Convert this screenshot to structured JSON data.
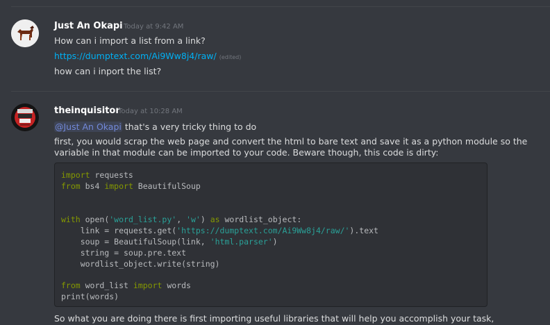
{
  "messages": [
    {
      "username": "Just An Okapi",
      "timestamp": "Today at 9:42 AM",
      "lines": [
        "How can i import a list from a link?",
        "how can i inport the list?"
      ],
      "link": "https://dumptext.com/Ai9Ww8j4/raw/",
      "edited": "(edited)"
    },
    {
      "username": "theinquisitor",
      "timestamp": "Today at 10:28 AM",
      "mention": "@Just An Okapi",
      "mention_rest": " that's a very tricky thing to do",
      "paragraph": "first, you would scrap the web page and convert the html to bare text and save it as a python module so the variable in that module can be imported to your code. Beware though, this code is dirty:",
      "code": {
        "l1_kw": "import",
        "l1_rest": " requests",
        "l2_kw1": "from",
        "l2_mod": " bs4 ",
        "l2_kw2": "import",
        "l2_rest": " BeautifulSoup",
        "l3_kw": "with",
        "l3_a": " open(",
        "l3_s1": "'word_list.py'",
        "l3_b": ", ",
        "l3_s2": "'w'",
        "l3_c": ") ",
        "l3_kw2": "as",
        "l3_d": " wordlist_object:",
        "l4_a": "    link = requests.get(",
        "l4_s": "'https://dumptext.com/Ai9Ww8j4/raw/'",
        "l4_b": ").text",
        "l5_a": "    soup = BeautifulSoup(link, ",
        "l5_s": "'html.parser'",
        "l5_b": ")",
        "l6": "    string = soup.pre.text",
        "l7": "    wordlist_object.write(string)",
        "l8_kw1": "from",
        "l8_mod": " word_list ",
        "l8_kw2": "import",
        "l8_rest": " words",
        "l9": "print(words)"
      },
      "after_code": "So what you are doing there is first importing useful libraries that will help you accomplish your task,"
    }
  ]
}
